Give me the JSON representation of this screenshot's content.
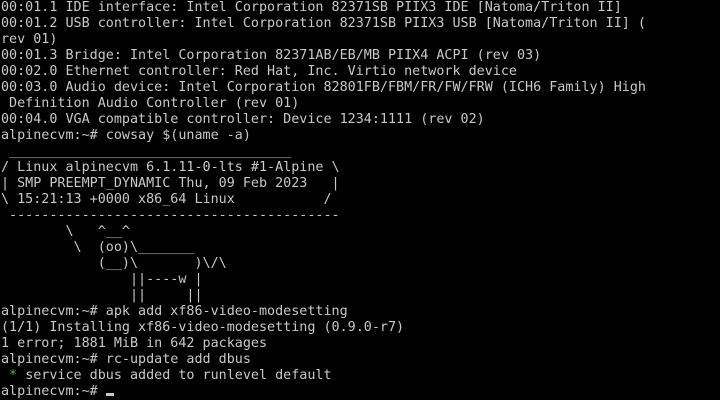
{
  "terminal": {
    "lines": [
      {
        "text": "00:01.1 IDE interface: Intel Corporation 82371SB PIIX3 IDE [Natoma/Triton II]"
      },
      {
        "text": "00:01.2 USB controller: Intel Corporation 82371SB PIIX3 USB [Natoma/Triton II] ("
      },
      {
        "text": "rev 01)"
      },
      {
        "text": "00:01.3 Bridge: Intel Corporation 82371AB/EB/MB PIIX4 ACPI (rev 03)"
      },
      {
        "text": "00:02.0 Ethernet controller: Red Hat, Inc. Virtio network device"
      },
      {
        "text": "00:03.0 Audio device: Intel Corporation 82801FB/FBM/FR/FW/FRW (ICH6 Family) High"
      },
      {
        "text": " Definition Audio Controller (rev 01)"
      },
      {
        "text": "00:04.0 VGA compatible controller: Device 1234:1111 (rev 02)"
      },
      {
        "text": "alpinecvm:~# cowsay $(uname -a)"
      },
      {
        "text": " ___________________________________"
      },
      {
        "text": "/ Linux alpinecvm 6.1.11-0-lts #1-Alpine \\"
      },
      {
        "text": "| SMP PREEMPT_DYNAMIC Thu, 09 Feb 2023   |"
      },
      {
        "text": "\\ 15:21:13 +0000 x86_64 Linux           /"
      },
      {
        "text": " -----------------------------------------"
      },
      {
        "text": "        \\   ^__^"
      },
      {
        "text": "         \\  (oo)\\_______"
      },
      {
        "text": "            (__)\\       )\\/\\"
      },
      {
        "text": "                ||----w |"
      },
      {
        "text": "                ||     ||"
      },
      {
        "text": "alpinecvm:~# apk add xf86-video-modesetting"
      },
      {
        "text": "(1/1) Installing xf86-video-modesetting (0.9.0-r7)"
      },
      {
        "text": "1 error; 1881 MiB in 642 packages"
      },
      {
        "text": "alpinecvm:~# rc-update add dbus"
      },
      {
        "bullet": " * ",
        "text": "service dbus added to runlevel default"
      },
      {
        "text": "alpinecvm:~# "
      }
    ],
    "colors": {
      "background": "#000000",
      "foreground": "#c8c8c8",
      "bullet": "#3fbf3f"
    }
  }
}
